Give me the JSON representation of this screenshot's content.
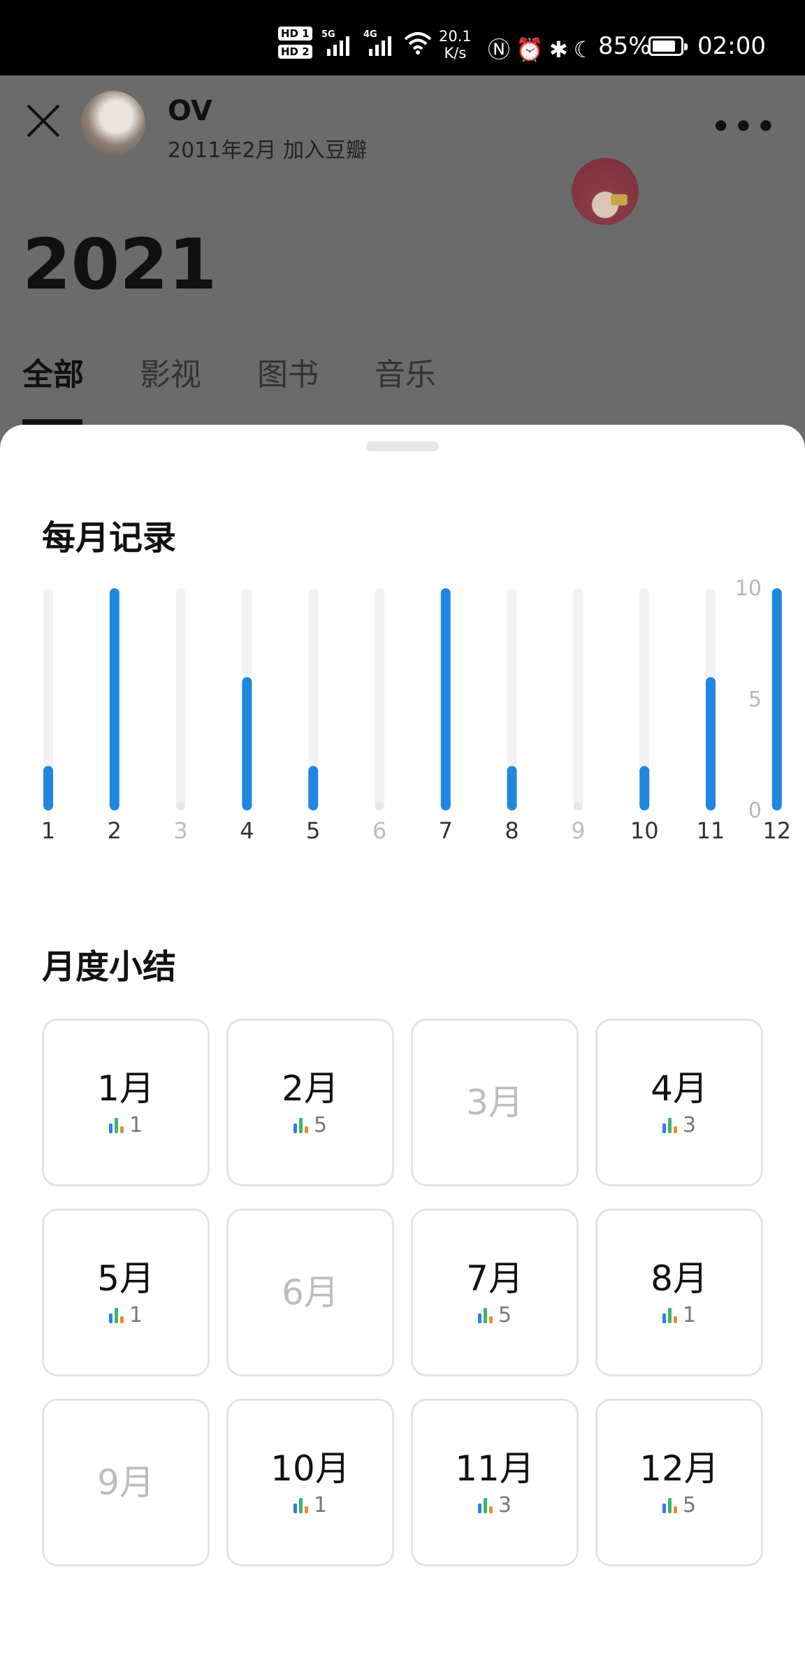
{
  "status_bar": {
    "hd1": "HD 1",
    "hd2": "HD 2",
    "net1": "5G",
    "net2": "4G",
    "speed_value": "20.1",
    "speed_unit": "K/s",
    "battery_pct": "85%",
    "battery_level": 0.85,
    "time": "02:00"
  },
  "background": {
    "username": "OV",
    "joined": "2011年2月 加入豆瓣",
    "year": "2021",
    "tabs": [
      {
        "label": "全部"
      },
      {
        "label": "影视"
      },
      {
        "label": "图书"
      },
      {
        "label": "音乐"
      }
    ]
  },
  "sheet": {
    "monthly_title": "每月记录",
    "summary_title": "月度小结",
    "months": [
      {
        "label": "1月",
        "count": "1"
      },
      {
        "label": "2月",
        "count": "5"
      },
      {
        "label": "3月",
        "count": ""
      },
      {
        "label": "4月",
        "count": "3"
      },
      {
        "label": "5月",
        "count": "1"
      },
      {
        "label": "6月",
        "count": ""
      },
      {
        "label": "7月",
        "count": "5"
      },
      {
        "label": "8月",
        "count": "1"
      },
      {
        "label": "9月",
        "count": ""
      },
      {
        "label": "10月",
        "count": "1"
      },
      {
        "label": "11月",
        "count": "3"
      },
      {
        "label": "12月",
        "count": "5"
      }
    ]
  },
  "colors": {
    "bar_active": "#2087e0",
    "bar_track": "#f2f2f2",
    "mini_blue": "#2f7fe0",
    "mini_green": "#3fb46a",
    "mini_orange": "#f08a2c"
  },
  "chart_data": {
    "type": "bar",
    "categories": [
      "1",
      "2",
      "3",
      "4",
      "5",
      "6",
      "7",
      "8",
      "9",
      "10",
      "11",
      "12"
    ],
    "values": [
      2,
      10,
      0,
      6,
      2,
      0,
      10,
      2,
      0,
      2,
      6,
      10
    ],
    "title": "",
    "xlabel": "",
    "ylabel": "",
    "ylim": [
      0,
      10
    ],
    "yticks": [
      0,
      5,
      10
    ],
    "y_axis_side": "right"
  }
}
